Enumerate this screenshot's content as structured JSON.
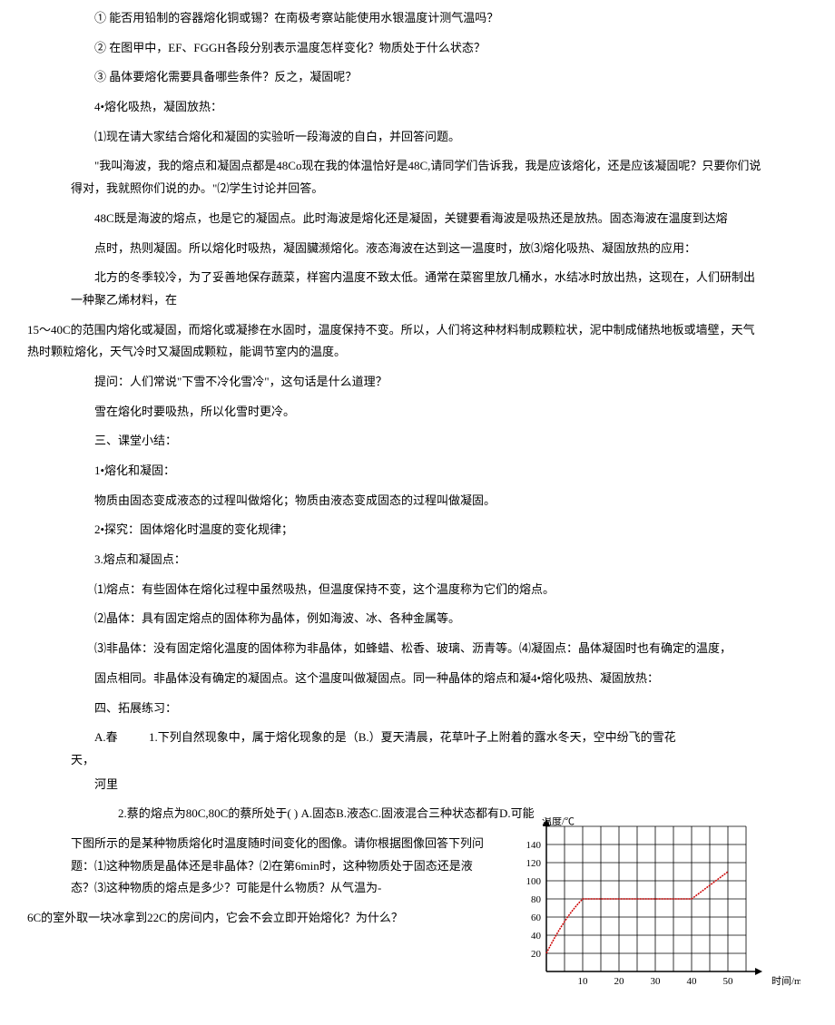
{
  "q1": "① 能否用铅制的容器熔化铜或锡？在南极考察站能使用水银温度计测气温吗？",
  "q2": "② 在图甲中，EF、FGGH各段分别表示温度怎样变化？物质处于什么状态？",
  "q3": "③ 晶体要熔化需要具备哪些条件？反之，凝固呢？",
  "h4": "4•熔化吸热，凝固放热：",
  "p1": "⑴现在请大家结合熔化和凝固的实验听一段海波的自白，并回答问题。",
  "p2": "\"我叫海波，我的熔点和凝固点都是48Co现在我的体温恰好是48C,请同学们告诉我，我是应该熔化，还是应该凝固呢？只要你们说得对，我就照你们说的办。\"⑵学生讨论并回答。",
  "p3": "48C既是海波的熔点，也是它的凝固点。此时海波是熔化还是凝固，关键要看海波是吸热还是放热。固态海波在温度到达熔",
  "p4": "点时，热则凝固。所以熔化时吸热，凝固臟濒熔化。液态海波在达到这一温度时，放⑶熔化吸热、凝固放热的应用：",
  "p5": "北方的冬季较冷，为了妥善地保存蔬菜，样窖内温度不致太低。通常在菜窖里放几桶水，水结冰时放出热，这现在，人们研制出一种聚乙烯材料，在",
  "p6": "15～40C的范围内熔化或凝固，而熔化或凝掺在水固时，温度保持不变。所以，人们将这种材料制成颗粒状，泥中制成储热地板或墙壁，天气热时颗粒熔化，天气冷时又凝固成颗粒，能调节室内的温度。",
  "p7": "提问：人们常说\"下雪不冷化雪冷\"，这句话是什么道理？",
  "p8": "雪在熔化时要吸热，所以化雪时更冷。",
  "p9": "三、课堂小结：",
  "s1": "1•熔化和凝固：",
  "s1b": "物质由固态变成液态的过程叫做熔化；物质由液态变成固态的过程叫做凝固。",
  "s2": "2•探究：固体熔化时温度的变化规律；",
  "s3": "3.熔点和凝固点：",
  "s3a": "⑴熔点：有些固体在熔化过程中虽然吸热，但温度保持不变，这个温度称为它们的熔点。",
  "s3b": "⑵晶体：具有固定熔点的固体称为晶体，例如海波、冰、各种金属等。",
  "s3c": "⑶非晶体：没有固定熔化温度的固体称为非晶体，如蜂蜡、松香、玻璃、沥青等。⑷凝固点：晶体凝固时也有确定的温度，",
  "s3d": "固点相同。非晶体没有确定的凝固点。这个温度叫做凝固点。同一种晶体的熔点和凝4•熔化吸热、凝固放热：",
  "ex_title": "四、拓展练习：",
  "ex1_lead_a": "A.春天，",
  "ex1_lead_b": "河里",
  "ex1_body": "1.下列自然现象中，属于熔化现象的是（B.）夏天清晨，花草叶子上附着的露水冬天，空中纷飞的雪花",
  "ex2": "2.蔡的熔点为80C,80C的蔡所处于( ) A.固态B.液态C.固液混合三种状态都有D.可能",
  "ex3": "下图所示的是某种物质熔化时温度随时间变化的图像。请你根据图像回答下列问题：⑴这种物质是晶体还是非晶体？⑵在第6min时，这种物质处于固态还是液态？⑶这种物质的熔点是多少？可能是什么物质？从气温为-",
  "ex4": "6C的室外取一块冰拿到22C的房间内，它会不会立即开始熔化？为什么？",
  "chart_data": {
    "type": "line",
    "title": "",
    "xlabel": "时间/min",
    "ylabel": "温度/℃",
    "x_ticks": [
      10,
      20,
      30,
      40,
      50
    ],
    "y_ticks": [
      20,
      40,
      60,
      80,
      100,
      120,
      140
    ],
    "xlim": [
      0,
      55
    ],
    "ylim": [
      0,
      150
    ],
    "points": [
      {
        "x": 0,
        "y": 20
      },
      {
        "x": 5,
        "y": 55
      },
      {
        "x": 10,
        "y": 80
      },
      {
        "x": 40,
        "y": 80
      },
      {
        "x": 50,
        "y": 110
      }
    ],
    "grid": true
  }
}
